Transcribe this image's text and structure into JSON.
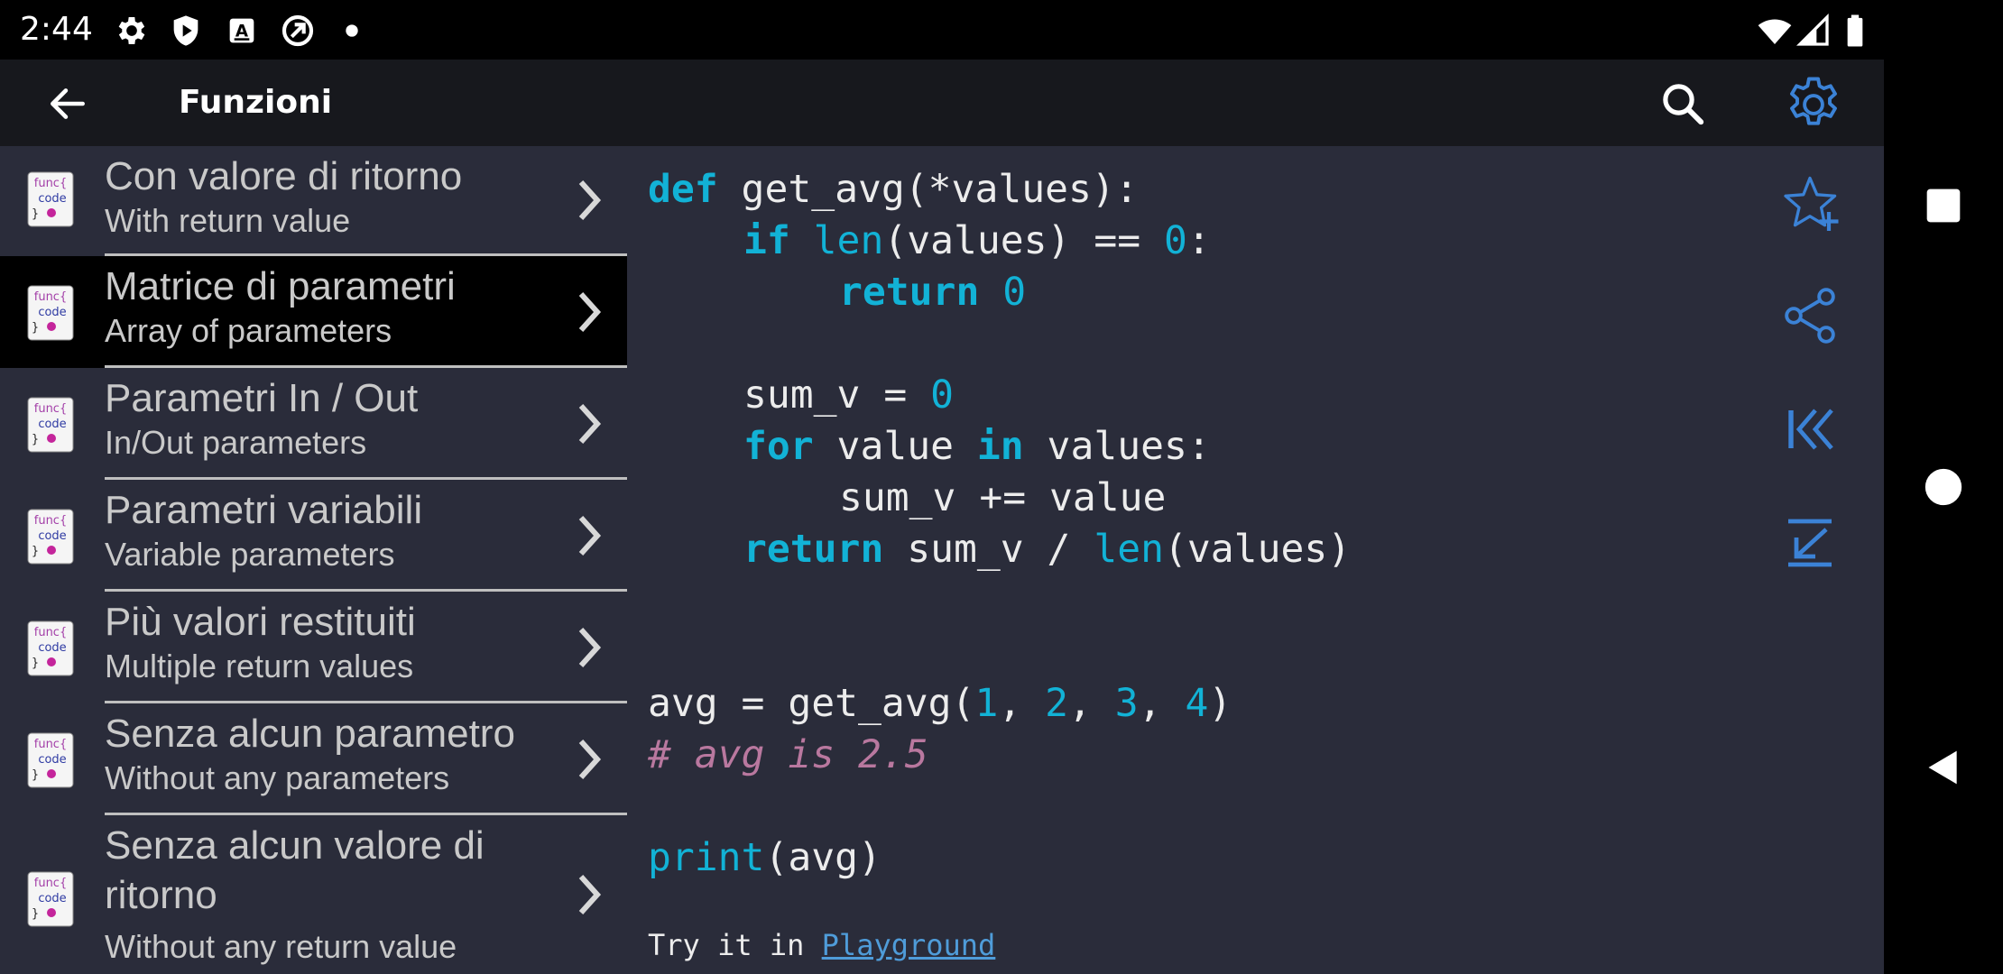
{
  "status_bar": {
    "time": "2:44",
    "left_icons": [
      "settings-icon",
      "shield-play-icon",
      "font-a-icon",
      "sync-icon",
      "dot-icon"
    ],
    "right_icons": [
      "wifi-icon",
      "signal-icon",
      "battery-icon"
    ]
  },
  "toolbar": {
    "title": "Funzioni",
    "back_icon": "arrow-left-icon",
    "search_icon": "search-icon",
    "settings_icon": "gear-icon",
    "accent": "#3b82d6"
  },
  "topics": [
    {
      "title": "Con valore di ritorno",
      "subtitle": "With return value"
    },
    {
      "title": "Matrice di parametri",
      "subtitle": "Array of parameters"
    },
    {
      "title": "Parametri In / Out",
      "subtitle": "In/Out parameters"
    },
    {
      "title": "Parametri variabili",
      "subtitle": "Variable parameters"
    },
    {
      "title": "Più valori restituiti",
      "subtitle": "Multiple return values"
    },
    {
      "title": "Senza alcun parametro",
      "subtitle": "Without any parameters"
    },
    {
      "title": "Senza alcun valore di ritorno",
      "subtitle": "Without any return value"
    }
  ],
  "topic_icon_text": {
    "line1": "func{",
    "line2": "code",
    "line3": "}"
  },
  "selected_topic": "Matrice di parametri",
  "code": {
    "l1": {
      "a": "def",
      "b": " get_avg(*values):"
    },
    "l2": {
      "a": "if",
      "b": "len",
      "c": "(values) == ",
      "d": "0",
      "e": ":"
    },
    "l3": {
      "a": "return",
      "b": "0"
    },
    "l4": {
      "a": "sum_v = ",
      "b": "0"
    },
    "l5": {
      "a": "for",
      "b": " value ",
      "c": "in",
      "d": " values:"
    },
    "l6": {
      "a": "sum_v += value"
    },
    "l7": {
      "a": "return",
      "b": " sum_v / ",
      "c": "len",
      "d": "(values)"
    },
    "l8": {
      "a": "avg = get_avg(",
      "b": "1",
      "c": ", ",
      "d": "2",
      "e": ", ",
      "f": "3",
      "g": ", ",
      "h": "4",
      "i": ")"
    },
    "l9": {
      "a": "# avg is 2.5"
    },
    "l10": {
      "a": "print",
      "b": "(avg)"
    }
  },
  "try_it": {
    "prefix": "Try it in ",
    "link": "Playground"
  },
  "actions": [
    "star-add-icon",
    "share-icon",
    "skip-to-start-icon",
    "collapse-icon"
  ],
  "nav": [
    "recents-square-icon",
    "home-circle-icon",
    "back-triangle-icon"
  ]
}
